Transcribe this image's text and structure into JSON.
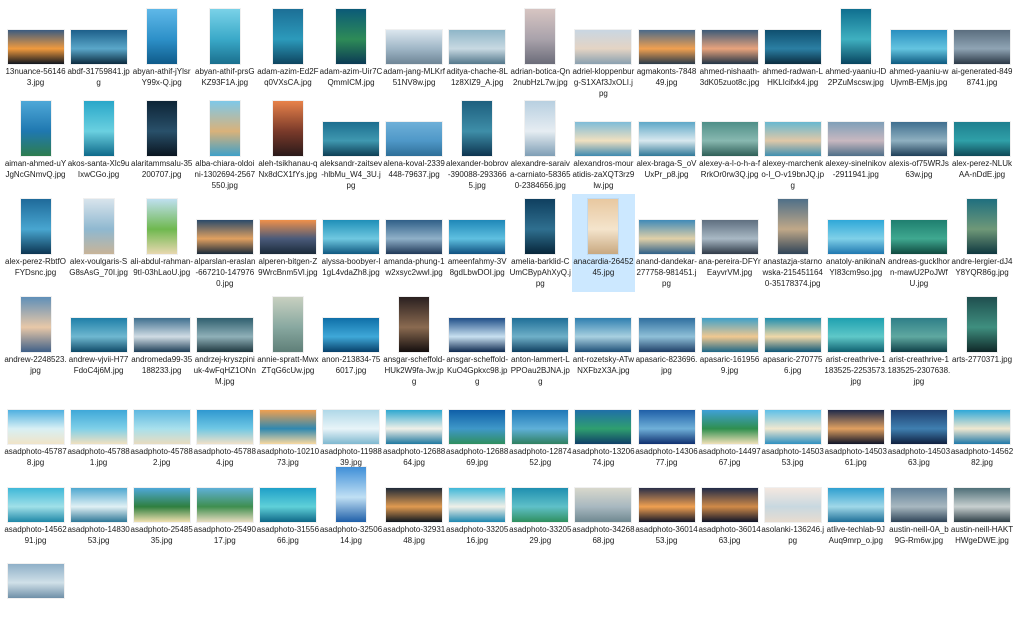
{
  "window": {
    "view": "large-icons",
    "selected_index": 41
  },
  "files": [
    {
      "name": "13nuance-561463.jpg",
      "o": "l",
      "c": [
        "#3a5b80",
        "#f09a3e",
        "#10161f"
      ]
    },
    {
      "name": "abdf-31759841.jpg",
      "o": "l",
      "c": [
        "#1d5f8a",
        "#5aa7c9",
        "#0c2b40"
      ]
    },
    {
      "name": "abyan-athif-jYlsrY99x-Q.jpg",
      "o": "p",
      "c": [
        "#5fb8e8",
        "#2d90c8",
        "#0f5b8a"
      ]
    },
    {
      "name": "abyan-athif-prsGKZ93F1A.jpg",
      "o": "p",
      "c": [
        "#7ad2e8",
        "#3aa9c8",
        "#1a6f8e"
      ]
    },
    {
      "name": "adam-azim-Ed2Fq0VXsCA.jpg",
      "o": "p",
      "c": [
        "#1c6f96",
        "#2c9abb",
        "#0e4560"
      ]
    },
    {
      "name": "adam-azim-Uir7CQmmICM.jpg",
      "o": "p",
      "c": [
        "#0b5a78",
        "#2e8b57",
        "#0b3a55"
      ]
    },
    {
      "name": "adam-jang-MLKrf51NV8w.jpg",
      "o": "l",
      "c": [
        "#dbe6ee",
        "#9fb6c6",
        "#6e8596"
      ]
    },
    {
      "name": "aditya-chache-8L1z8XIZ9_A.jpg",
      "o": "l",
      "c": [
        "#8fb6c8",
        "#c8d9e2",
        "#54788c"
      ]
    },
    {
      "name": "adrian-botica-Qn2nubHzL7w.jpg",
      "o": "p",
      "c": [
        "#d7c5c2",
        "#a9a2ab",
        "#6b6c79"
      ]
    },
    {
      "name": "adriel-kloppenburg-S1XAf3JxOLI.jpg",
      "o": "l",
      "c": [
        "#c9d6e2",
        "#e4d4c4",
        "#8aa0b0"
      ]
    },
    {
      "name": "agmakonts-784849.jpg",
      "o": "l",
      "c": [
        "#4a6a8a",
        "#f0a050",
        "#2a3a4a"
      ]
    },
    {
      "name": "ahmed-nishaath-3dK05zuot8c.jpg",
      "o": "l",
      "c": [
        "#3c5a78",
        "#e8a37c",
        "#223446"
      ]
    },
    {
      "name": "ahmed-radwan-LHKLIcifxk4.jpg",
      "o": "l",
      "c": [
        "#0f4f6f",
        "#2b7fa3",
        "#0a2d40"
      ]
    },
    {
      "name": "ahmed-yaaniu-lD2PZuMscsw.jpg",
      "o": "p",
      "c": [
        "#0f6f8f",
        "#3fb0c0",
        "#084560"
      ]
    },
    {
      "name": "ahmed-yaaniu-wUjvmB-EMjs.jpg",
      "o": "l",
      "c": [
        "#2a8fbf",
        "#64c4e0",
        "#0e5a80"
      ]
    },
    {
      "name": "ai-generated-8498741.jpg",
      "o": "l",
      "c": [
        "#5b6e7f",
        "#8fa4b4",
        "#2b3846"
      ]
    },
    {
      "name": "aiman-ahmed-uYJgNcGNmvQ.jpg",
      "o": "p",
      "c": [
        "#4fa8d8",
        "#1f78b0",
        "#2e7d4f"
      ]
    },
    {
      "name": "akos-santa-Xlc9uIxwCGo.jpg",
      "o": "p",
      "c": [
        "#2aa7c9",
        "#6ad0e0",
        "#0f6a8a"
      ]
    },
    {
      "name": "alaritammsalu-35200707.jpg",
      "o": "p",
      "c": [
        "#0d2436",
        "#29506a",
        "#0a1520"
      ]
    },
    {
      "name": "alba-chiara-oldoini-1302694-2567550.jpg",
      "o": "p",
      "c": [
        "#7fc8e8",
        "#d9b27a",
        "#3fa0c8"
      ]
    },
    {
      "name": "aleh-tsikhanau-qNx8dCX1fYs.jpg",
      "o": "p",
      "c": [
        "#e8824a",
        "#7a3a2a",
        "#2a1a1a"
      ]
    },
    {
      "name": "aleksandr-zaitsev-hlbMu_W4_3U.jpg",
      "o": "l",
      "c": [
        "#1d6e8f",
        "#3f98b0",
        "#0e3f55"
      ]
    },
    {
      "name": "alena-koval-2339448-79637.jpg",
      "o": "l",
      "c": [
        "#6fb0d8",
        "#4f98c8",
        "#2f6f98"
      ]
    },
    {
      "name": "alexander-bobrov-390088-2933665.jpg",
      "o": "p",
      "c": [
        "#1e5f7e",
        "#3e8ea8",
        "#0e3550"
      ]
    },
    {
      "name": "alexandre-saraiva-carniato-583650-2384656.jpg",
      "o": "p",
      "c": [
        "#b8cfe0",
        "#e6edf2",
        "#7f9eb5"
      ]
    },
    {
      "name": "alexandros-mouratidis-zaXQT3rz9lw.jpg",
      "o": "l",
      "c": [
        "#7fbcd8",
        "#f0e0c0",
        "#3f8ab0"
      ]
    },
    {
      "name": "alex-braga-S_oVUxPr_p8.jpg",
      "o": "l",
      "c": [
        "#5fa8c8",
        "#d8e8ee",
        "#2f7898"
      ]
    },
    {
      "name": "alexey-a-l-o-h-a-fRrkOr0rw3Q.jpg",
      "o": "l",
      "c": [
        "#4f8f88",
        "#88b8b0",
        "#2f5f58"
      ]
    },
    {
      "name": "alexey-marchenko-l_O-v19bnJQ.jpg",
      "o": "l",
      "c": [
        "#68b8d0",
        "#e0c8a8",
        "#3f8fb0"
      ]
    },
    {
      "name": "alexey-sinelnikov-2911941.jpg",
      "o": "l",
      "c": [
        "#7f9fb8",
        "#c8b8c0",
        "#4f6f88"
      ]
    },
    {
      "name": "alexis-of75WRJs63w.jpg",
      "o": "l",
      "c": [
        "#3f6f8f",
        "#8fb0c0",
        "#1f3f58"
      ]
    },
    {
      "name": "alex-perez-NLUkAA-nDdE.jpg",
      "o": "l",
      "c": [
        "#1f7f8f",
        "#2fa0a8",
        "#0f4a58"
      ]
    },
    {
      "name": "alex-perez-RbtfOFYDsnc.jpg",
      "o": "p",
      "c": [
        "#1f6a9a",
        "#48a6d0",
        "#0c3552"
      ]
    },
    {
      "name": "alex-voulgaris-SG8sAsG_70I.jpg",
      "o": "p",
      "c": [
        "#d8e4ec",
        "#8fb8d0",
        "#c8b498"
      ]
    },
    {
      "name": "ali-abdul-rahman-9tI-03hLaoU.jpg",
      "o": "p",
      "c": [
        "#bfe0f0",
        "#6fb84f",
        "#e8d8b0"
      ]
    },
    {
      "name": "alparslan-eraslan-667210-1479760.jpg",
      "o": "l",
      "c": [
        "#2a4a6a",
        "#e0a060",
        "#1a2a3a"
      ]
    },
    {
      "name": "alperen-bitgen-Z9WrcBnm5Vl.jpg",
      "o": "l",
      "c": [
        "#f0904a",
        "#4a5a7a",
        "#1a2a3a"
      ]
    },
    {
      "name": "alyssa-boobyer-l1gL4vdaZh8.jpg",
      "o": "l",
      "c": [
        "#1f8fb8",
        "#6fc8e0",
        "#0f5880"
      ]
    },
    {
      "name": "amanda-phung-1w2xsyc2wwI.jpg",
      "o": "l",
      "c": [
        "#2f5f88",
        "#8fb0c8",
        "#1f3858"
      ]
    },
    {
      "name": "ameenfahmy-3V8gdLbwDOI.jpg",
      "o": "l",
      "c": [
        "#1f88b8",
        "#5fc0e0",
        "#0f5080"
      ]
    },
    {
      "name": "amelia-barklid-CUmCBypAhXyQ.jpg",
      "o": "p",
      "c": [
        "#0f3f5f",
        "#2f6f8f",
        "#07263a"
      ]
    },
    {
      "name": "anacardia-2645245.jpg",
      "o": "p",
      "c": [
        "#e8c8a0",
        "#f4e4cc",
        "#c8a880"
      ]
    },
    {
      "name": "anand-dandekar-277758-981451.jpg",
      "o": "l",
      "c": [
        "#3f8ab8",
        "#e0d0a8",
        "#2f6088"
      ]
    },
    {
      "name": "ana-pereira-DFYrEayvrVM.jpg",
      "o": "l",
      "c": [
        "#5f6f80",
        "#a8b8c4",
        "#2f3a48"
      ]
    },
    {
      "name": "anastazja-starnowska-2154511640-35178374.jpg",
      "o": "p",
      "c": [
        "#4f6f88",
        "#c0a888",
        "#2f4458"
      ]
    },
    {
      "name": "anatoly-anikinaNYI83cm9so.jpg",
      "o": "l",
      "c": [
        "#2fa8d8",
        "#7fd0e8",
        "#1f78b0"
      ]
    },
    {
      "name": "andreas-gucklhorn-mawU2PoJWfU.jpg",
      "o": "l",
      "c": [
        "#1f7f6f",
        "#3fa890",
        "#0f4a40"
      ]
    },
    {
      "name": "andre-lergier-dJ4Y8YQR86g.jpg",
      "o": "p",
      "c": [
        "#1f6f7f",
        "#6f9878",
        "#0f3840"
      ]
    },
    {
      "name": "andrew-2248523.jpg",
      "o": "p",
      "c": [
        "#5f8fb8",
        "#e8c8a8",
        "#3f6088"
      ]
    },
    {
      "name": "andrew-vjvii-H77FdoC4j6M.jpg",
      "o": "l",
      "c": [
        "#1f7fa8",
        "#6fb8d0",
        "#0f4a68"
      ]
    },
    {
      "name": "andromeda99-35188233.jpg",
      "o": "l",
      "c": [
        "#3f6f8f",
        "#d0dce4",
        "#1f3f58"
      ]
    },
    {
      "name": "andrzej-kryszpiniuk-4wFqHZ1ONnM.jpg",
      "o": "l",
      "c": [
        "#2f5f6f",
        "#8fb0b8",
        "#1f3840"
      ]
    },
    {
      "name": "annie-spratt-MwxZTqG6cUw.jpg",
      "o": "p",
      "c": [
        "#c8d0c0",
        "#88a8a0",
        "#5f7f78"
      ]
    },
    {
      "name": "anon-213834-756017.jpg",
      "o": "l",
      "c": [
        "#0f6fa8",
        "#3fa8d8",
        "#07406a"
      ]
    },
    {
      "name": "ansgar-scheffold-HUk2W9fa-Jw.jpg",
      "o": "p",
      "c": [
        "#2a2020",
        "#8a6a50",
        "#140e0e"
      ]
    },
    {
      "name": "ansgar-scheffold-KuO4Gpkxc98.jpg",
      "o": "l",
      "c": [
        "#1f4f88",
        "#c8e0f0",
        "#0f2a50"
      ]
    },
    {
      "name": "anton-lammert-LPPOau2BJNA.jpg",
      "o": "l",
      "c": [
        "#1f6f98",
        "#6fb0c8",
        "#0f3f60"
      ]
    },
    {
      "name": "ant-rozetsky-ATwNXFbzX3A.jpg",
      "o": "l",
      "c": [
        "#2f7fb0",
        "#a8d0e0",
        "#1f5078"
      ]
    },
    {
      "name": "apasaric-823696.jpg",
      "o": "l",
      "c": [
        "#2f6fa0",
        "#8fc0d8",
        "#1f4068"
      ]
    },
    {
      "name": "apasaric-1619569.jpg",
      "o": "l",
      "c": [
        "#3fa0c8",
        "#f0c890",
        "#1f6888"
      ]
    },
    {
      "name": "apasaric-2707756.jpg",
      "o": "l",
      "c": [
        "#1f8fb0",
        "#f0d8a8",
        "#0f5878"
      ]
    },
    {
      "name": "arist-creathrive-1183525-2253573.jpg",
      "o": "l",
      "c": [
        "#1fa0b0",
        "#5fc8c8",
        "#0f6070"
      ]
    },
    {
      "name": "arist-creathrive-1183525-2307638.jpg",
      "o": "l",
      "c": [
        "#2f7f88",
        "#5fa8a0",
        "#0f4048"
      ]
    },
    {
      "name": "arts-2770371.jpg",
      "o": "p",
      "c": [
        "#1f4f4f",
        "#3f8f7f",
        "#0f2828"
      ]
    },
    {
      "name": "asadphoto-457878.jpg",
      "o": "l",
      "c": [
        "#4fb0e0",
        "#d8f0f4",
        "#f0e4c8"
      ]
    },
    {
      "name": "asadphoto-457881.jpg",
      "o": "l",
      "c": [
        "#3fa8d8",
        "#80d0e8",
        "#f0e0c0"
      ]
    },
    {
      "name": "asadphoto-457882.jpg",
      "o": "l",
      "c": [
        "#5fb8e0",
        "#a8e0ec",
        "#e8dcc0"
      ]
    },
    {
      "name": "asadphoto-457884.jpg",
      "o": "l",
      "c": [
        "#2f98d0",
        "#70c8e4",
        "#f0e0c8"
      ]
    },
    {
      "name": "asadphoto-1021073.jpg",
      "o": "l",
      "c": [
        "#f0a050",
        "#2f88b0",
        "#f8d8a0"
      ]
    },
    {
      "name": "asadphoto-1198839.jpg",
      "o": "l",
      "c": [
        "#b0d8e8",
        "#e8f4f8",
        "#7fb8d0"
      ]
    },
    {
      "name": "asadphoto-1268864.jpg",
      "o": "l",
      "c": [
        "#2fa8d0",
        "#f0f0e8",
        "#1f78a0"
      ]
    },
    {
      "name": "asadphoto-1268869.jpg",
      "o": "l",
      "c": [
        "#0f5fa8",
        "#3f98c8",
        "#2f8f5f"
      ]
    },
    {
      "name": "asadphoto-1287452.jpg",
      "o": "l",
      "c": [
        "#1f78b8",
        "#5fb0d8",
        "#2f8060"
      ]
    },
    {
      "name": "asadphoto-1320674.jpg",
      "o": "l",
      "c": [
        "#1f6fa8",
        "#2f9f6f",
        "#0f3f68"
      ]
    },
    {
      "name": "asadphoto-1430677.jpg",
      "o": "l",
      "c": [
        "#1f5fa8",
        "#6fb0d8",
        "#0f3070"
      ]
    },
    {
      "name": "asadphoto-1449767.jpg",
      "o": "l",
      "c": [
        "#3fa0d8",
        "#2f8f4f",
        "#f0e0b8"
      ]
    },
    {
      "name": "asadphoto-1450353.jpg",
      "o": "l",
      "c": [
        "#5fc0e8",
        "#f0e8d0",
        "#2f90c0"
      ]
    },
    {
      "name": "asadphoto-1450361.jpg",
      "o": "l",
      "c": [
        "#1f2a4a",
        "#e0a060",
        "#0f1428"
      ]
    },
    {
      "name": "asadphoto-1450363.jpg",
      "o": "l",
      "c": [
        "#1f3f6f",
        "#3f7fb0",
        "#0f2040"
      ]
    },
    {
      "name": "asadphoto-1456282.jpg",
      "o": "l",
      "c": [
        "#2fa8d8",
        "#f0e8d0",
        "#1f78a8"
      ]
    },
    {
      "name": "asadphoto-1456291.jpg",
      "o": "l",
      "c": [
        "#3fb8d8",
        "#a0e0e8",
        "#1f88a8"
      ]
    },
    {
      "name": "asadphoto-1483053.jpg",
      "o": "l",
      "c": [
        "#4fa8d0",
        "#e0f0f4",
        "#2f7898"
      ]
    },
    {
      "name": "asadphoto-2548535.jpg",
      "o": "l",
      "c": [
        "#4fa8d8",
        "#2f7f3f",
        "#f0e0b0"
      ]
    },
    {
      "name": "asadphoto-2549017.jpg",
      "o": "l",
      "c": [
        "#5fb0d8",
        "#3f8f4f",
        "#e8dcc0"
      ]
    },
    {
      "name": "asadphoto-3155666.jpg",
      "o": "l",
      "c": [
        "#1fa0c8",
        "#5fd0d8",
        "#0f6888"
      ]
    },
    {
      "name": "asadphoto-3250614.jpg",
      "o": "p",
      "c": [
        "#3f8fd8",
        "#c0e0f4",
        "#1f5fa8"
      ]
    },
    {
      "name": "asadphoto-3293148.jpg",
      "o": "l",
      "c": [
        "#1f2a38",
        "#e09a50",
        "#0f1820"
      ]
    },
    {
      "name": "asadphoto-3320516.jpg",
      "o": "l",
      "c": [
        "#3fb8d8",
        "#f0f0e8",
        "#1f88b0"
      ]
    },
    {
      "name": "asadphoto-3320529.jpg",
      "o": "l",
      "c": [
        "#1f8fb0",
        "#5fc0c8",
        "#2f8f5f"
      ]
    },
    {
      "name": "asadphoto-3426868.jpg",
      "o": "l",
      "c": [
        "#d8d8cc",
        "#a8b8c0",
        "#6f8890"
      ]
    },
    {
      "name": "asadphoto-3601453.jpg",
      "o": "l",
      "c": [
        "#2a2f48",
        "#f0a050",
        "#151828"
      ]
    },
    {
      "name": "asadphoto-3601463.jpg",
      "o": "l",
      "c": [
        "#1f2a48",
        "#d08a48",
        "#0f1428"
      ]
    },
    {
      "name": "asolanki-136246.jpg",
      "o": "l",
      "c": [
        "#f4e8e0",
        "#c8d8e0",
        "#e8dcd0"
      ]
    },
    {
      "name": "atlive-techlab-9JAuq9mrp_o.jpg",
      "o": "l",
      "c": [
        "#2fa0d0",
        "#a0d8e8",
        "#1f6f98"
      ]
    },
    {
      "name": "austin-neill-0A_b9G-Rm6w.jpg",
      "o": "l",
      "c": [
        "#5f7f98",
        "#a8b8c0",
        "#2f4458"
      ]
    },
    {
      "name": "austin-neill-HAKTHWgeDWE.jpg",
      "o": "l",
      "c": [
        "#4f6f78",
        "#c8d0d0",
        "#2f4048"
      ]
    },
    {
      "name": "",
      "o": "l",
      "c": [
        "#8fb0c8",
        "#d0e0e8",
        "#6f90a8"
      ]
    }
  ]
}
